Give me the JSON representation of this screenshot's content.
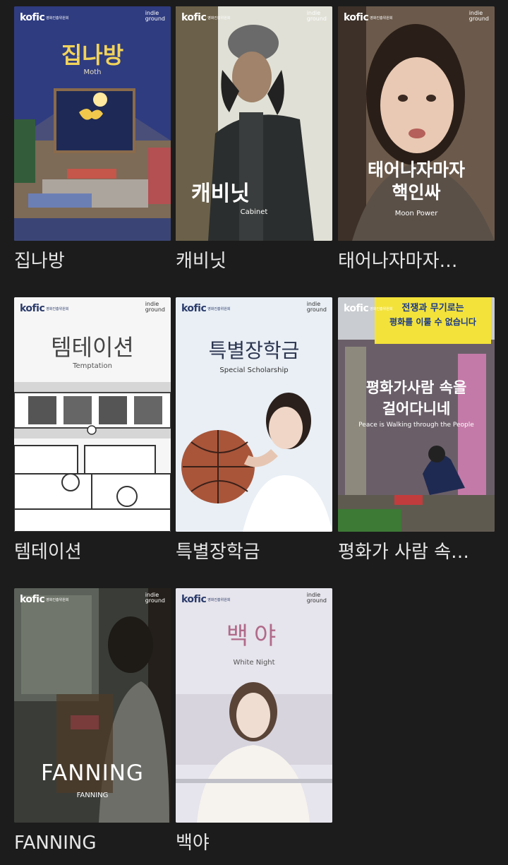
{
  "items": [
    {
      "title": "집나방",
      "poster_title": "집나방",
      "poster_subtitle": "Moth"
    },
    {
      "title": "캐비닛",
      "poster_title": "캐비닛",
      "poster_subtitle": "Cabinet"
    },
    {
      "title": "태어나자마자…",
      "poster_title_line1": "태어나자마자",
      "poster_title_line2": "핵인싸",
      "poster_subtitle": "Moon Power"
    },
    {
      "title": "템테이션",
      "poster_title": "템테이션",
      "poster_subtitle": "Temptation"
    },
    {
      "title": "특별장학금",
      "poster_title": "특별장학금",
      "poster_subtitle": "Special Scholarship"
    },
    {
      "title": "평화가 사람 속…",
      "poster_title_line1": "평화가사람 속을",
      "poster_title_line2": "걸어다니네",
      "poster_subtitle": "Peace is Walking through the People",
      "banner_line1": "전쟁과 무기로는",
      "banner_line2": "평화를 이룰 수 없습니다"
    },
    {
      "title": "FANNING",
      "poster_title": "FANNING",
      "poster_subtitle": "FANNING"
    },
    {
      "title": "백야",
      "poster_title": "백야",
      "poster_subtitle": "White Night"
    }
  ],
  "brand": {
    "kofic": "kofic",
    "kofic_sub": "영화진흥위원회",
    "indie_line1": "indie",
    "indie_line2": "ground"
  }
}
